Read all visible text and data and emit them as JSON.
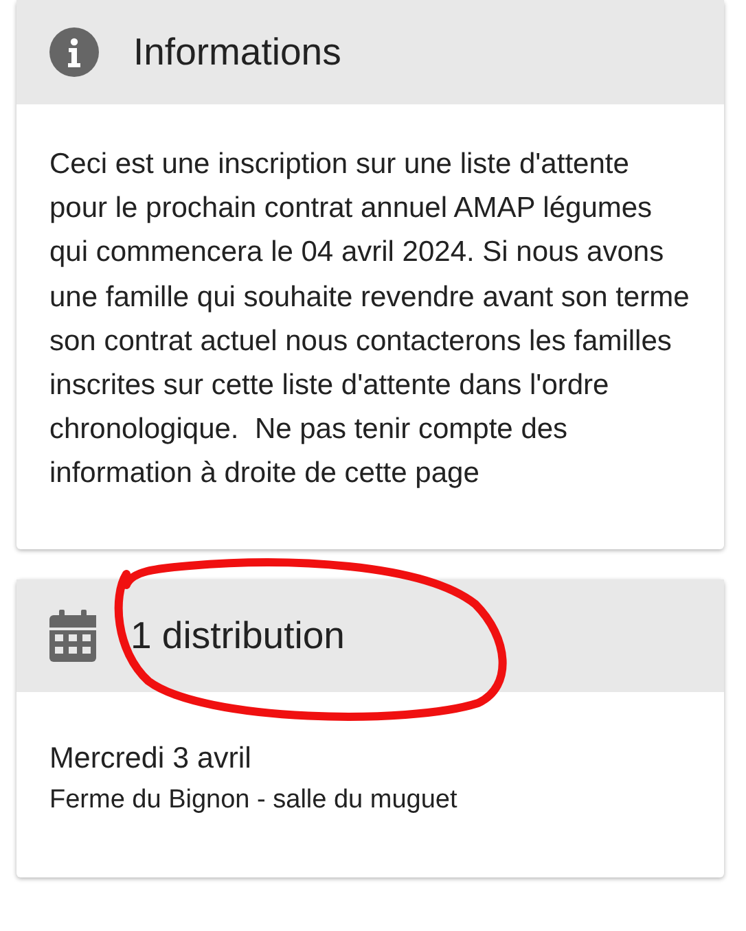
{
  "cards": [
    {
      "kind": "info",
      "title": "Informations",
      "body": "Ceci est une inscription sur une liste d'attente pour le prochain contrat annuel AMAP légumes qui commencera le 04 avril 2024. Si nous avons une famille qui souhaite revendre avant son terme son contrat actuel nous contacterons les familles inscrites sur cette liste d'attente dans l'ordre chronologique.  Ne pas tenir compte des information à droite de cette page"
    },
    {
      "kind": "calendar",
      "title": "1 distribution",
      "date": "Mercredi 3 avril",
      "place": "Ferme du Bignon - salle du muguet"
    }
  ]
}
